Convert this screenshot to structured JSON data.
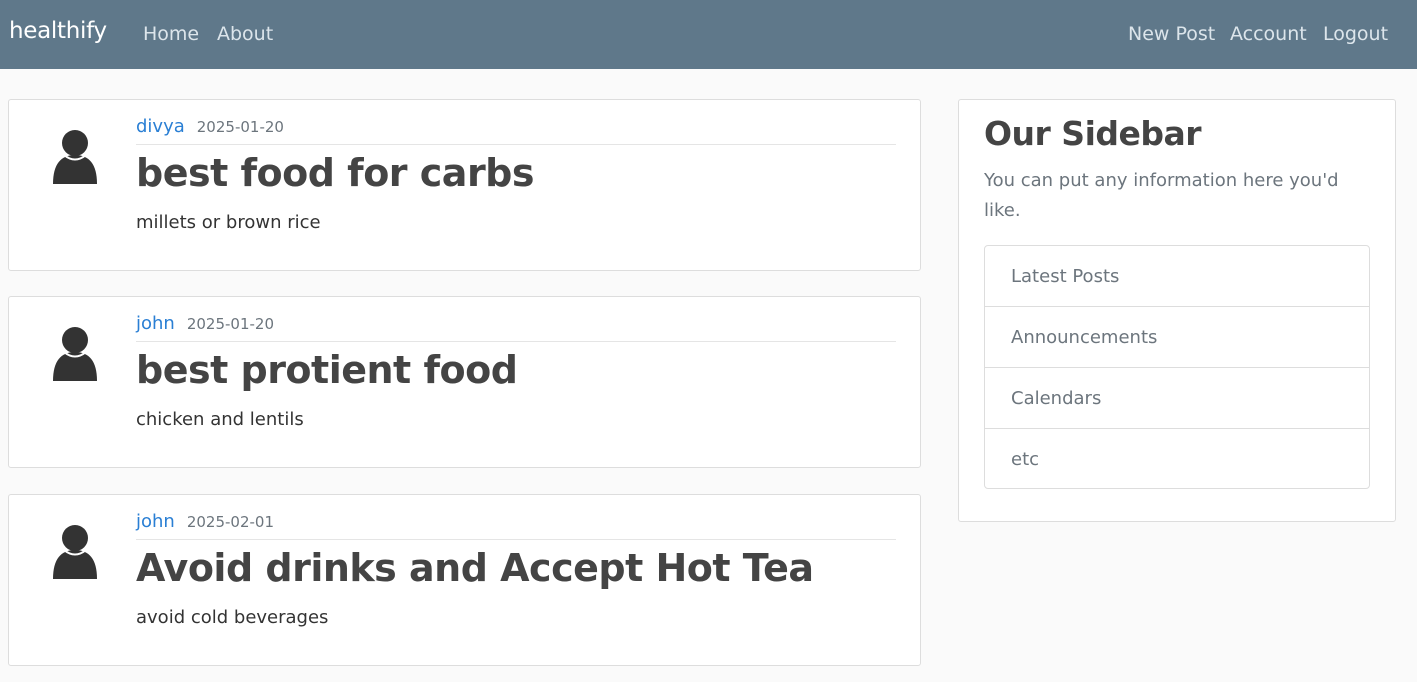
{
  "navbar": {
    "brand": "healthify",
    "left_links": [
      "Home",
      "About"
    ],
    "right_links": [
      "New Post",
      "Account",
      "Logout"
    ],
    "background_color": "#5f788a"
  },
  "posts": [
    {
      "author": "divya",
      "date": "2025-01-20",
      "title": "best food for carbs",
      "content": "millets or brown rice",
      "avatar_icon": "user-icon"
    },
    {
      "author": "john",
      "date": "2025-01-20",
      "title": "best protient food",
      "content": "chicken and lentils",
      "avatar_icon": "user-icon"
    },
    {
      "author": "john",
      "date": "2025-02-01",
      "title": "Avoid drinks and Accept Hot Tea",
      "content": "avoid cold beverages",
      "avatar_icon": "user-icon"
    }
  ],
  "sidebar": {
    "title": "Our Sidebar",
    "text": "You can put any information here you'd like.",
    "items": [
      "Latest Posts",
      "Announcements",
      "Calendars",
      "etc"
    ]
  },
  "colors": {
    "link": "#2a7fd4",
    "muted": "#6c757d"
  }
}
